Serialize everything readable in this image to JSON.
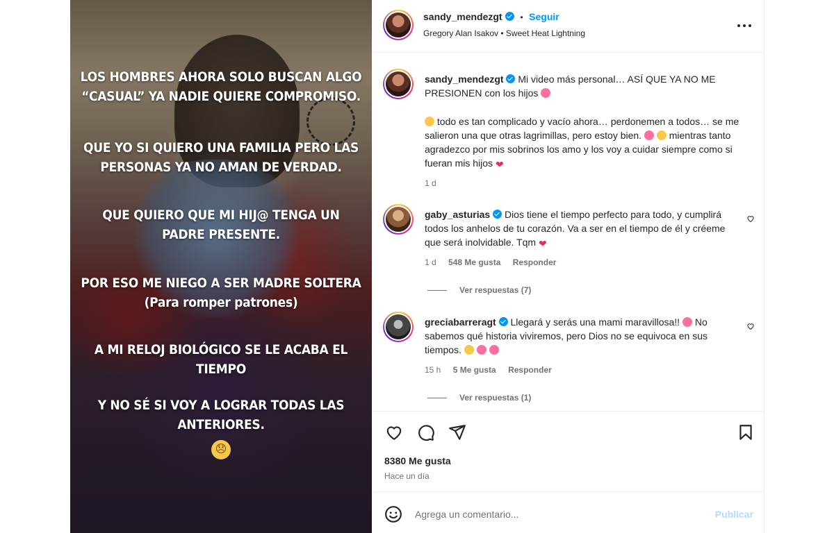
{
  "video": {
    "overlay_lines": [
      [
        "LOS HOMBRES AHORA SOLO BUSCAN ALGO",
        "“CASUAL” YA NADIE QUIERE COMPROMISO."
      ],
      [
        "QUE YO SI QUIERO UNA FAMILIA PERO LAS",
        "PERSONAS YA NO AMAN DE VERDAD."
      ],
      [
        "QUE QUIERO QUE MI HIJ@ TENGA UN",
        "PADRE PRESENTE."
      ],
      [
        "POR ESO ME NIEGO A SER MADRE SOLTERA",
        "(Para romper patrones)"
      ],
      [
        "A MI RELOJ BIOLÓGICO SE LE ACABA EL",
        "TIEMPO"
      ],
      [
        "Y NO SÉ SI VOY A LOGRAR TODAS LAS",
        "ANTERIORES."
      ]
    ],
    "emoji": "😞"
  },
  "header": {
    "username": "sandy_mendezgt",
    "separator": "•",
    "follow_label": "Seguir",
    "audio": "Gregory Alan Isakov • Sweet Heat Lightning",
    "more": "•••"
  },
  "caption": {
    "username": "sandy_mendezgt",
    "text1": "Mi video más personal… ASÍ QUE YA NO ME PRESIONEN con los hijos",
    "text2a": "todo es tan complicado y vacío ahora… perdonemen a todos… se me salieron una que otras lagrimillas, pero estoy bien.",
    "text2b": "mientras tanto agradezco por mis sobrinos los amo y los voy a cuidar siempre como si fueran mis hijos",
    "time": "1 d"
  },
  "comments": [
    {
      "username": "gaby_asturias",
      "text": "Dios tiene el tiempo perfecto para todo, y cumplirá todos los anhelos de tu corazón. Va a ser en el tiempo de él y créeme que será inolvidable. Tqm",
      "time": "1 d",
      "likes": "548 Me gusta",
      "reply": "Responder",
      "view_replies": "Ver respuestas (7)"
    },
    {
      "username": "greciabarreragt",
      "text1": "Llegará y serás una mami maravillosa!!",
      "text2": "No sabemos qué historia viviremos, pero Dios no se equivoca en sus tiempos.",
      "time": "15 h",
      "likes": "5 Me gusta",
      "reply": "Responder",
      "view_replies": "Ver respuestas (1)"
    }
  ],
  "post": {
    "likes": "8380 Me gusta",
    "when": "Hace un día"
  },
  "add_comment": {
    "placeholder": "Agrega un comentario...",
    "publish": "Publicar"
  },
  "colors": {
    "accent": "#0095f6",
    "text": "#262626",
    "muted": "#737373",
    "heart": "#ee2a5c"
  },
  "icons": [
    "volume-icon",
    "verified-icon",
    "more-icon",
    "heart-icon",
    "comment-icon",
    "share-icon",
    "bookmark-icon",
    "emoji-icon"
  ]
}
